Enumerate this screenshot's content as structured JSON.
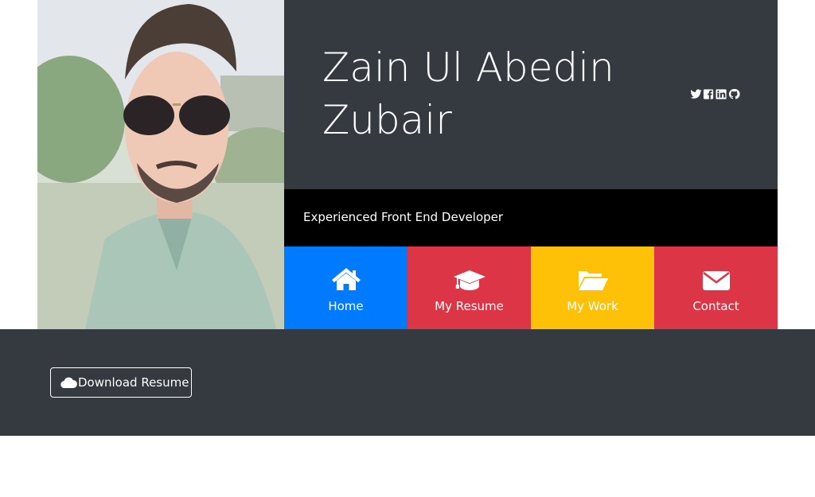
{
  "profile": {
    "name": "Zain Ul Abedin Zubair",
    "tagline": "Experienced Front End Developer"
  },
  "social": [
    {
      "icon": "twitter-icon"
    },
    {
      "icon": "facebook-icon"
    },
    {
      "icon": "linkedin-icon"
    },
    {
      "icon": "github-icon"
    }
  ],
  "nav": [
    {
      "label": "Home",
      "icon": "home-icon",
      "color": "#007bff"
    },
    {
      "label": "My Resume",
      "icon": "graduation-cap-icon",
      "color": "#dc3545"
    },
    {
      "label": "My Work",
      "icon": "folder-open-icon",
      "color": "#ffc107"
    },
    {
      "label": "Contact",
      "icon": "envelope-icon",
      "color": "#dc3545"
    }
  ],
  "actions": {
    "download_label": "Download Resume",
    "download_icon": "cloud-icon"
  },
  "colors": {
    "panel_dark": "#343a40",
    "tagline_bg": "#000000",
    "text": "#ffffff"
  }
}
